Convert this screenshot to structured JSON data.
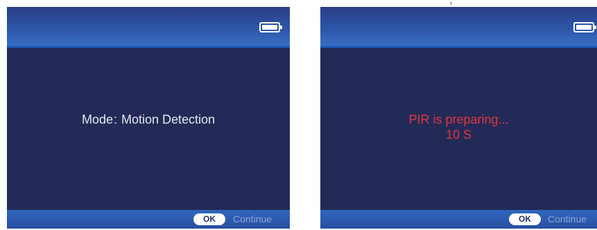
{
  "screens": [
    {
      "message": {
        "label": "Mode",
        "separator": ":",
        "value": "Motion Detection"
      },
      "softkey": {
        "button": "OK",
        "action": "Continue"
      }
    },
    {
      "message": {
        "line1": "PIR is preparing...",
        "line2": "10 S"
      },
      "softkey": {
        "button": "OK",
        "action": "Continue"
      }
    }
  ],
  "icons": {
    "battery": "battery-full-icon"
  },
  "colors": {
    "screen_background": "#232a57",
    "header_bar": "#2d56aa",
    "footer_bar": "#2f66be",
    "text_normal": "#e6e8f0",
    "text_alert": "#e0353d",
    "continue_text": "#8ea3d6"
  }
}
